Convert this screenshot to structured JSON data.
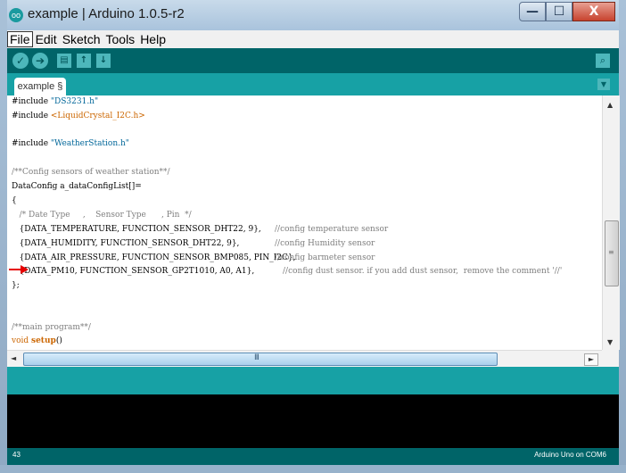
{
  "window": {
    "title": "example | Arduino 1.0.5-r2",
    "app_icon": "oo",
    "buttons": {
      "minimize": "—",
      "maximize": "☐",
      "close": "X"
    }
  },
  "menu": [
    "File",
    "Edit",
    "Sketch",
    "Tools",
    "Help"
  ],
  "toolbar": {
    "verify": "✓",
    "upload": "➔",
    "new": "▤",
    "open": "↑",
    "save": "↓",
    "serial_monitor": "⌕",
    "icons": [
      "check-icon",
      "arrow-right-icon",
      "new-file-icon",
      "open-icon",
      "save-icon",
      "magnifier-icon"
    ]
  },
  "tabs": {
    "active": "example §",
    "menu_glyph": "▼"
  },
  "code": [
    "#include \"DS3231.h\"",
    "#include <LiquidCrystal_I2C.h>",
    "",
    "#include \"WeatherStation.h\"",
    "",
    "/**Config sensors of weather station**/",
    "DataConfig a_dataConfigList[]=",
    "{",
    "   /* Date Type     ,    Sensor Type      , Pin  */",
    "   {DATA_TEMPERATURE, FUNCTION_SENSOR_DHT22, 9},",
    "   {DATA_HUMIDITY, FUNCTION_SENSOR_DHT22, 9},",
    "   {DATA_AIR_PRESSURE, FUNCTION_SENSOR_BMP085, PIN_I2C},",
    "   {DATA_PM10, FUNCTION_SENSOR_GP2T1010, A0, A1},",
    "};",
    "",
    "",
    "/**main program**/",
    "void setup()"
  ],
  "code_parts": {
    "l1a": "#include ",
    "l1b": "\"DS3231.h\"",
    "l2a": "#include ",
    "l2b": "<LiquidCrystal_I2C.h>",
    "l4a": "#include ",
    "l4b": "\"WeatherStation.h\"",
    "l6": "/**Config sensors of weather station**/",
    "l7": "DataConfig a_dataConfigList[]=",
    "l8": "{",
    "l9": "   /* Date Type     ,    Sensor Type      , Pin  */",
    "l10a": "   {DATA_TEMPERATURE, FUNCTION_SENSOR_DHT22, 9},",
    "l10b": "//config temperature sensor",
    "l11a": "   {DATA_HUMIDITY, FUNCTION_SENSOR_DHT22, 9},",
    "l11b": "//config Humidity sensor",
    "l12a": "   {DATA_AIR_PRESSURE, FUNCTION_SENSOR_BMP085, PIN_I2C},",
    "l12b": "//config barmeter sensor",
    "l13a": "   {DATA_PM10, FUNCTION_SENSOR_GP2T1010, A0, A1},",
    "l13b": "//config dust sensor. if you add dust sensor,  remove the comment '//'",
    "l14": "};",
    "l17": "/**main program**/",
    "l18a": "void ",
    "l18b": "setup",
    "l18c": "()"
  },
  "scrollbars": {
    "up": "▲",
    "down": "▼",
    "left": "◄",
    "right": "►",
    "h_grip": "III",
    "v_grip": "≡"
  },
  "status": {
    "line": "43",
    "board": "Arduino Uno on COM6"
  },
  "colors": {
    "toolbar": "#006468",
    "tabbar": "#17a1a5",
    "console": "#000000",
    "arrow": "#e60000"
  }
}
